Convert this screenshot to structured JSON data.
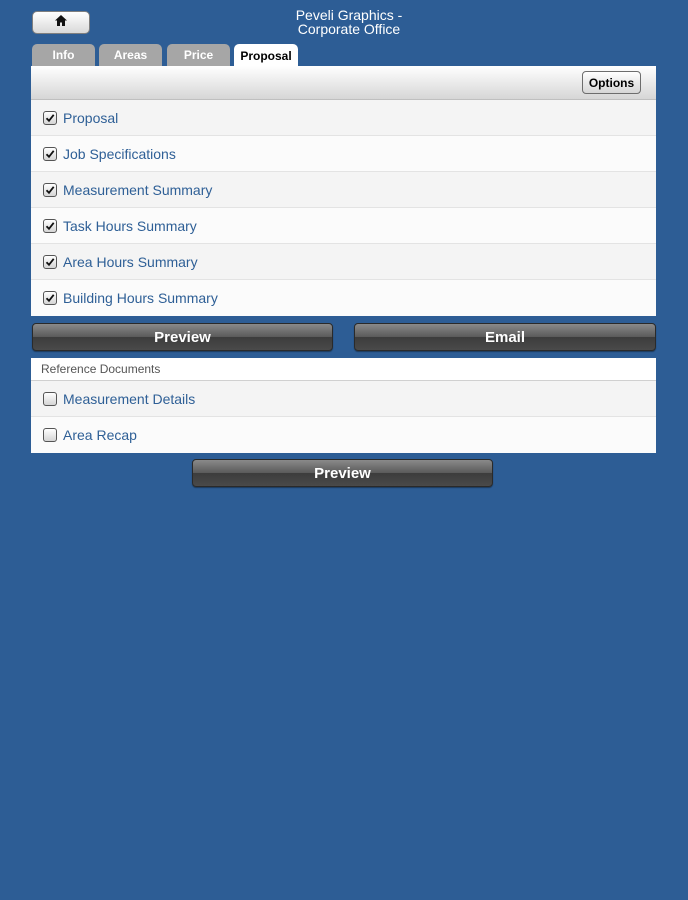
{
  "header": {
    "title_line1": "Peveli Graphics -",
    "title_line2": "Corporate Office",
    "home_icon": "home-icon"
  },
  "tabs": [
    {
      "label": "Info",
      "active": false
    },
    {
      "label": "Areas",
      "active": false
    },
    {
      "label": "Price",
      "active": false
    },
    {
      "label": "Proposal",
      "active": true
    }
  ],
  "proposal": {
    "options_label": "Options",
    "items": [
      {
        "label": "Proposal",
        "checked": true
      },
      {
        "label": "Job Specifications",
        "checked": true
      },
      {
        "label": "Measurement Summary",
        "checked": true
      },
      {
        "label": "Task Hours Summary",
        "checked": true
      },
      {
        "label": "Area Hours Summary",
        "checked": true
      },
      {
        "label": "Building Hours Summary",
        "checked": true
      }
    ],
    "preview_label": "Preview",
    "email_label": "Email"
  },
  "reference": {
    "header": "Reference Documents",
    "items": [
      {
        "label": "Measurement Details",
        "checked": false
      },
      {
        "label": "Area Recap",
        "checked": false
      }
    ],
    "preview_label": "Preview"
  },
  "colors": {
    "background": "#2d5d95",
    "link_text": "#2e5f96",
    "tab_inactive": "#a6a6a6"
  }
}
